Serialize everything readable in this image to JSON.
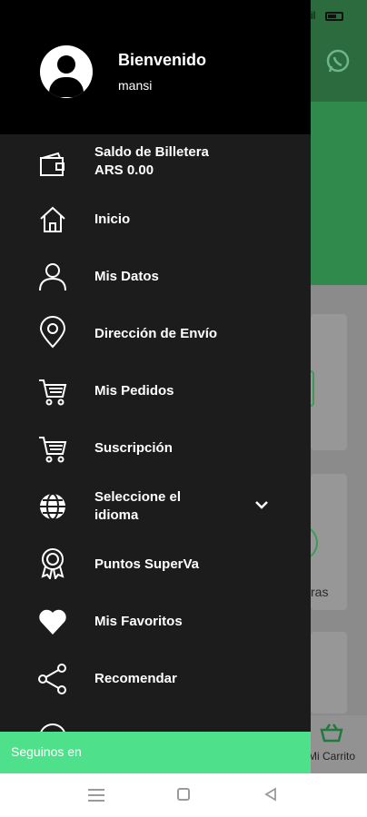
{
  "background_app": {
    "partial_text": "ras",
    "cart_label": "Mi Carrito"
  },
  "drawer": {
    "welcome": "Bienvenido",
    "username": "mansi",
    "items": [
      {
        "label": "Saldo de Billetera",
        "sublabel": "ARS  0.00",
        "icon": "wallet-icon"
      },
      {
        "label": "Inicio",
        "icon": "home-icon"
      },
      {
        "label": "Mis Datos",
        "icon": "user-icon"
      },
      {
        "label": "Dirección de Envío",
        "icon": "location-pin-icon"
      },
      {
        "label": "Mis Pedidos",
        "icon": "cart-icon"
      },
      {
        "label": "Suscripción",
        "icon": "cart-icon"
      },
      {
        "label": "Seleccione el",
        "label2": "idioma",
        "icon": "globe-icon",
        "expand_icon": "chevron-down-icon"
      },
      {
        "label": "Puntos SuperVa",
        "icon": "award-badge-icon"
      },
      {
        "label": "Mis Favoritos",
        "icon": "heart-icon"
      },
      {
        "label": "Recomendar",
        "icon": "share-icon"
      }
    ],
    "follow_label": "Seguinos en"
  },
  "colors": {
    "drawer_bg": "#1c1c1c",
    "header_bg": "#000000",
    "accent_green": "#4ee08a"
  }
}
